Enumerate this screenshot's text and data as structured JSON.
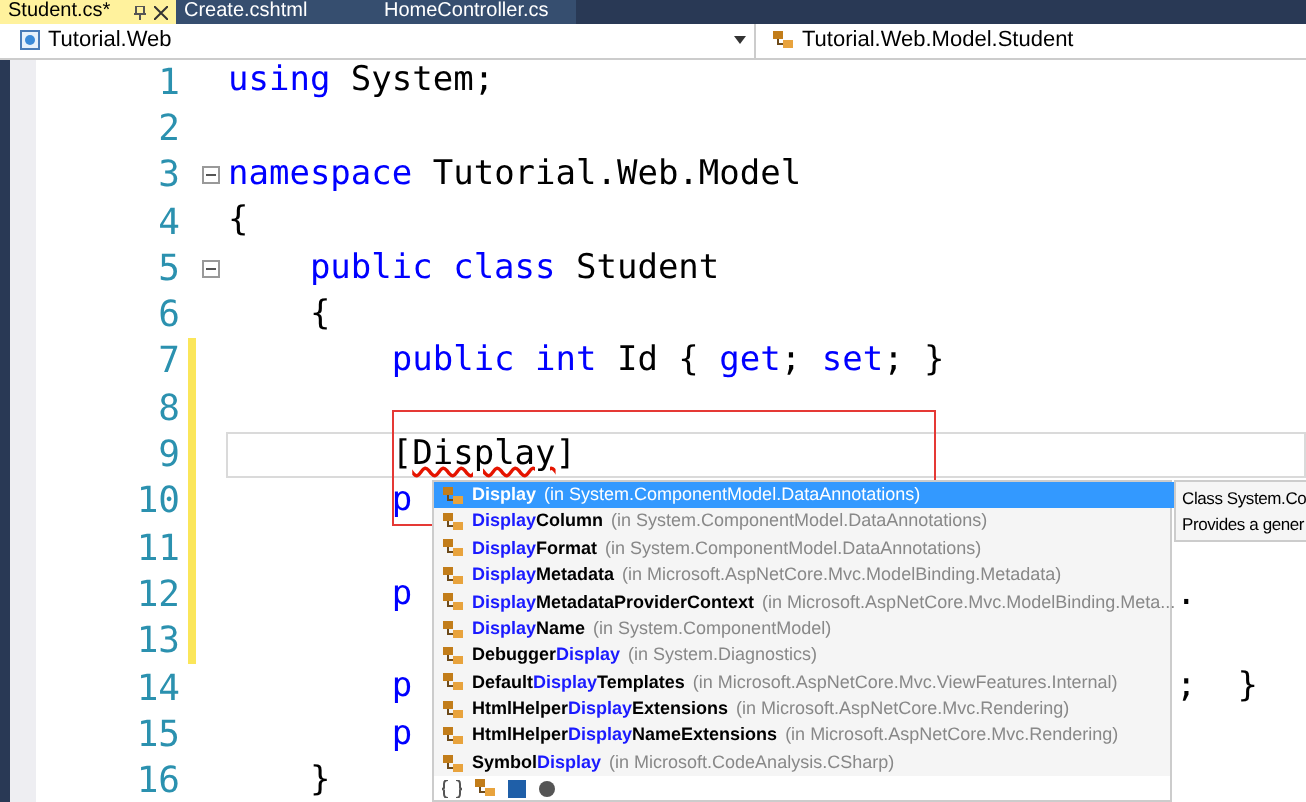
{
  "tabs": [
    {
      "label": "Student.cs*",
      "selected": true
    },
    {
      "label": "Create.cshtml",
      "selected": false
    },
    {
      "label": "HomeController.cs",
      "selected": false
    }
  ],
  "navigation": {
    "project": "Tutorial.Web",
    "member": "Tutorial.Web.Model.Student"
  },
  "editor": {
    "lines": [
      {
        "number": "1",
        "changed": false,
        "tokens": [
          {
            "kind": "keyword",
            "text": "using"
          },
          {
            "kind": "plain",
            "text": " System;"
          }
        ]
      },
      {
        "number": "2",
        "changed": false
      },
      {
        "number": "3",
        "changed": false,
        "fold": true,
        "tokens": [
          {
            "kind": "keyword",
            "text": "namespace"
          },
          {
            "kind": "plain",
            "text": " Tutorial.Web.Model"
          }
        ]
      },
      {
        "number": "4",
        "changed": false,
        "tokens": [
          {
            "kind": "plain",
            "text": "{"
          }
        ]
      },
      {
        "number": "5",
        "changed": false,
        "fold": true,
        "tokens": [
          {
            "kind": "keyword",
            "text": "    public class"
          },
          {
            "kind": "plain",
            "text": " Student"
          }
        ]
      },
      {
        "number": "6",
        "changed": false,
        "tokens": [
          {
            "kind": "plain",
            "text": "    {"
          }
        ]
      },
      {
        "number": "7",
        "changed": true,
        "tokens": [
          {
            "kind": "keyword",
            "text": "        public int"
          },
          {
            "kind": "plain",
            "text": " Id { "
          },
          {
            "kind": "keyword",
            "text": "get"
          },
          {
            "kind": "plain",
            "text": "; "
          },
          {
            "kind": "keyword",
            "text": "set"
          },
          {
            "kind": "plain",
            "text": "; }"
          }
        ]
      },
      {
        "number": "8",
        "changed": true
      },
      {
        "number": "9",
        "changed": true,
        "current": true,
        "tokens": [
          {
            "kind": "plain",
            "text": "        ["
          },
          {
            "kind": "error",
            "text": "Display"
          },
          {
            "kind": "plain",
            "text": "]"
          }
        ]
      },
      {
        "number": "10",
        "changed": true,
        "tokens": [
          {
            "kind": "keyword",
            "text": "        p"
          }
        ]
      },
      {
        "number": "11",
        "changed": true
      },
      {
        "number": "12",
        "changed": true,
        "tokens": [
          {
            "kind": "keyword",
            "text": "        p"
          }
        ],
        "tail": "."
      },
      {
        "number": "13",
        "changed": true
      },
      {
        "number": "14",
        "changed": false,
        "tokens": [
          {
            "kind": "keyword",
            "text": "        p"
          }
        ],
        "tail": ";  }"
      },
      {
        "number": "15",
        "changed": false,
        "tokens": [
          {
            "kind": "keyword",
            "text": "        p"
          }
        ]
      },
      {
        "number": "16",
        "changed": false,
        "tokens": [
          {
            "kind": "plain",
            "text": "    }"
          }
        ]
      }
    ]
  },
  "completion": {
    "items": [
      {
        "match": "Display",
        "namespace": "(in System.ComponentModel.DataAnnotations)",
        "selected": true
      },
      {
        "match": "Display",
        "suffix": "Column",
        "namespace": "(in System.ComponentModel.DataAnnotations)",
        "selected": false
      },
      {
        "match": "Display",
        "suffix": "Format",
        "namespace": "(in System.ComponentModel.DataAnnotations)",
        "selected": false
      },
      {
        "match": "Display",
        "suffix": "Metadata",
        "namespace": "(in Microsoft.AspNetCore.Mvc.ModelBinding.Metadata)",
        "selected": false
      },
      {
        "match": "Display",
        "suffix": "MetadataProviderContext",
        "namespace": "(in Microsoft.AspNetCore.Mvc.ModelBinding.Meta...",
        "selected": false
      },
      {
        "match": "Display",
        "suffix": "Name",
        "namespace": "(in System.ComponentModel)",
        "selected": false
      },
      {
        "prefix": "Debugger",
        "match": "Display",
        "namespace": "(in System.Diagnostics)",
        "selected": false
      },
      {
        "prefix": "Default",
        "match": "Display",
        "suffix": "Templates",
        "namespace": "(in Microsoft.AspNetCore.Mvc.ViewFeatures.Internal)",
        "selected": false
      },
      {
        "prefix": "HtmlHelper",
        "match": "Display",
        "suffix": "Extensions",
        "namespace": "(in Microsoft.AspNetCore.Mvc.Rendering)",
        "selected": false
      },
      {
        "prefix": "HtmlHelper",
        "match": "Display",
        "suffix": "NameExtensions",
        "namespace": "(in Microsoft.AspNetCore.Mvc.Rendering)",
        "selected": false
      },
      {
        "prefix": "Symbol",
        "match": "Display",
        "namespace": "(in Microsoft.CodeAnalysis.CSharp)",
        "selected": false
      }
    ]
  },
  "tooltip": {
    "lines": [
      "Class System.Co",
      "Provides a gener"
    ]
  }
}
